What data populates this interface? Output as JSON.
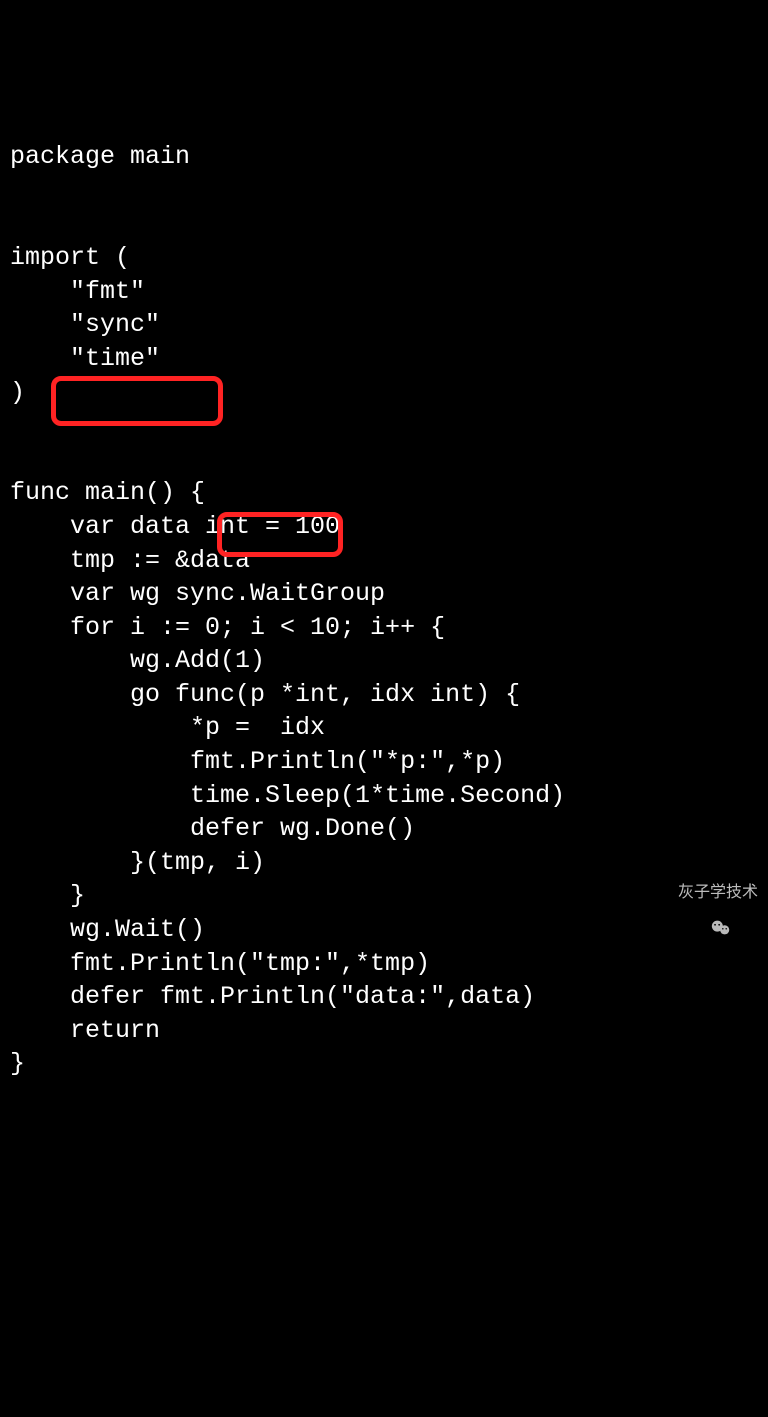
{
  "code": {
    "lines": [
      "package main",
      "",
      "",
      "import (",
      "    \"fmt\"",
      "    \"sync\"",
      "    \"time\"",
      ")",
      "",
      "",
      "func main() {",
      "    var data int = 100",
      "    tmp := &data",
      "    var wg sync.WaitGroup",
      "    for i := 0; i < 10; i++ {",
      "        wg.Add(1)",
      "        go func(p *int, idx int) {",
      "            *p =  idx",
      "            fmt.Println(\"*p:\",*p)",
      "            time.Sleep(1*time.Second)",
      "            defer wg.Done()",
      "        }(tmp, i)",
      "    }",
      "    wg.Wait()",
      "    fmt.Println(\"tmp:\",*tmp)",
      "    defer fmt.Println(\"data:\",data)",
      "    return",
      "}"
    ],
    "highlights": [
      {
        "lineIndex": 12,
        "text": "tmp := &data"
      },
      {
        "lineIndex": 16,
        "text": "p *int,"
      }
    ]
  },
  "watermark": {
    "text": "灰子学技术"
  }
}
